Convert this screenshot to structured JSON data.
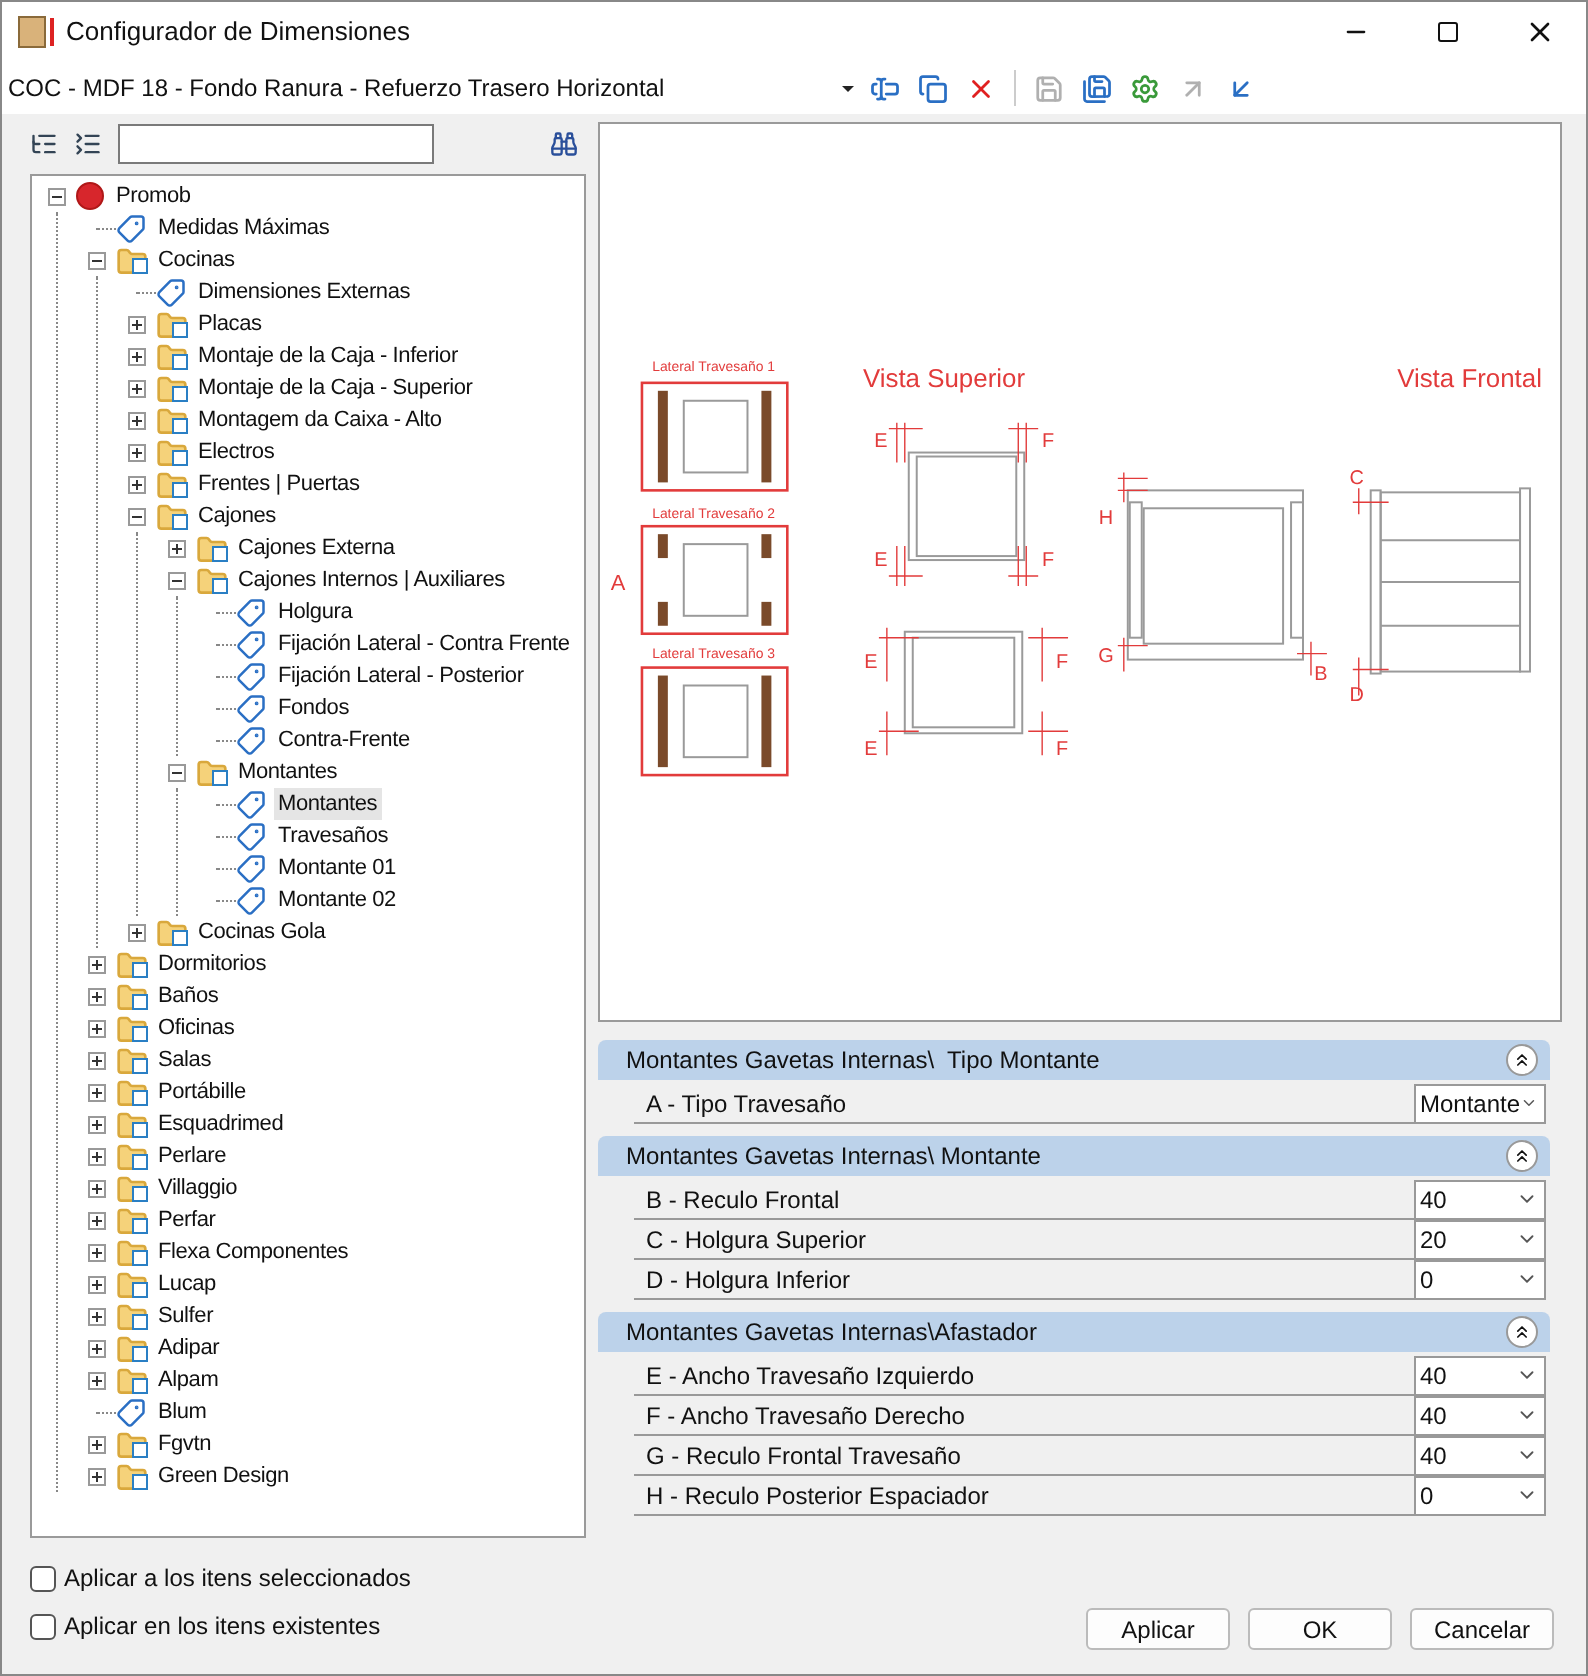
{
  "window": {
    "title": "Configurador de Dimensiones"
  },
  "toolbar": {
    "combo_value": "COC - MDF 18 - Fondo Ranura - Refuerzo Trasero Horizontal",
    "tools": [
      {
        "kind": "rename",
        "disabled": false
      },
      {
        "kind": "copy",
        "disabled": false
      },
      {
        "kind": "delete",
        "disabled": false
      },
      {
        "kind": "save",
        "disabled": true
      },
      {
        "kind": "saveas",
        "disabled": false
      },
      {
        "kind": "settings",
        "disabled": false
      },
      {
        "kind": "import",
        "disabled": true
      },
      {
        "kind": "export",
        "disabled": false
      }
    ]
  },
  "tree": {
    "items": [
      {
        "label": "Promob",
        "kind": "root",
        "expanded": true,
        "selected": false,
        "children": [
          {
            "label": "Medidas Máximas",
            "kind": "tag",
            "selected": false
          },
          {
            "label": "Cocinas",
            "kind": "folder",
            "expanded": true,
            "selected": false,
            "children": [
              {
                "label": "Dimensiones Externas",
                "kind": "tag",
                "selected": false
              },
              {
                "label": "Placas",
                "kind": "folder",
                "expanded": false,
                "selected": false
              },
              {
                "label": "Montaje de la Caja - Inferior",
                "kind": "folder",
                "expanded": false,
                "selected": false
              },
              {
                "label": "Montaje de la Caja - Superior",
                "kind": "folder",
                "expanded": false,
                "selected": false
              },
              {
                "label": "Montagem da Caixa - Alto",
                "kind": "folder",
                "expanded": false,
                "selected": false
              },
              {
                "label": "Electros",
                "kind": "folder",
                "expanded": false,
                "selected": false
              },
              {
                "label": "Frentes | Puertas",
                "kind": "folder",
                "expanded": false,
                "selected": false
              },
              {
                "label": "Cajones",
                "kind": "folder",
                "expanded": true,
                "selected": false,
                "children": [
                  {
                    "label": "Cajones Externa",
                    "kind": "folder",
                    "expanded": false,
                    "selected": false
                  },
                  {
                    "label": "Cajones Internos | Auxiliares",
                    "kind": "folder",
                    "expanded": true,
                    "selected": false,
                    "children": [
                      {
                        "label": "Holgura",
                        "kind": "tag",
                        "selected": false
                      },
                      {
                        "label": "Fijación Lateral - Contra Frente",
                        "kind": "tag",
                        "selected": false
                      },
                      {
                        "label": "Fijación Lateral - Posterior",
                        "kind": "tag",
                        "selected": false
                      },
                      {
                        "label": "Fondos",
                        "kind": "tag",
                        "selected": false
                      },
                      {
                        "label": "Contra-Frente",
                        "kind": "tag",
                        "selected": false
                      }
                    ]
                  },
                  {
                    "label": "Montantes",
                    "kind": "folder",
                    "expanded": true,
                    "selected": false,
                    "children": [
                      {
                        "label": "Montantes",
                        "kind": "tag",
                        "selected": true
                      },
                      {
                        "label": "Travesaños",
                        "kind": "tag",
                        "selected": false
                      },
                      {
                        "label": "Montante 01",
                        "kind": "tag",
                        "selected": false
                      },
                      {
                        "label": "Montante 02",
                        "kind": "tag",
                        "selected": false
                      }
                    ]
                  }
                ]
              },
              {
                "label": "Cocinas Gola",
                "kind": "folder",
                "expanded": false,
                "selected": false
              }
            ]
          },
          {
            "label": "Dormitorios",
            "kind": "folder",
            "expanded": false,
            "selected": false
          },
          {
            "label": "Baños",
            "kind": "folder",
            "expanded": false,
            "selected": false
          },
          {
            "label": "Oficinas",
            "kind": "folder",
            "expanded": false,
            "selected": false
          },
          {
            "label": "Salas",
            "kind": "folder",
            "expanded": false,
            "selected": false
          },
          {
            "label": "Portábille",
            "kind": "folder",
            "expanded": false,
            "selected": false
          },
          {
            "label": "Esquadrimed",
            "kind": "folder",
            "expanded": false,
            "selected": false
          },
          {
            "label": "Perlare",
            "kind": "folder",
            "expanded": false,
            "selected": false
          },
          {
            "label": "Villaggio",
            "kind": "folder",
            "expanded": false,
            "selected": false
          },
          {
            "label": "Perfar",
            "kind": "folder",
            "expanded": false,
            "selected": false
          },
          {
            "label": "Flexa Componentes",
            "kind": "folder",
            "expanded": false,
            "selected": false
          },
          {
            "label": "Lucap",
            "kind": "folder",
            "expanded": false,
            "selected": false
          },
          {
            "label": "Sulfer",
            "kind": "folder",
            "expanded": false,
            "selected": false
          },
          {
            "label": "Adipar",
            "kind": "folder",
            "expanded": false,
            "selected": false
          },
          {
            "label": "Alpam",
            "kind": "folder",
            "expanded": false,
            "selected": false
          },
          {
            "label": "Blum",
            "kind": "tag",
            "selected": false
          },
          {
            "label": "Fgvtn",
            "kind": "folder",
            "expanded": false,
            "selected": false
          },
          {
            "label": "Green Design",
            "kind": "folder",
            "expanded": false,
            "selected": false
          }
        ]
      }
    ]
  },
  "options": [
    {
      "label": "Aplicar a los itens seleccionados",
      "checked": false
    },
    {
      "label": "Aplicar en los itens existentes",
      "checked": false
    }
  ],
  "diagram": {
    "labels": [
      "Lateral Travesaño 1",
      "Lateral Travesaño 2",
      "Lateral Travesaño 3",
      "A",
      "Vista Superior",
      "Vista Frontal",
      "E",
      "F",
      "E",
      "F",
      "E",
      "F",
      "E",
      "F",
      "H",
      "G",
      "B",
      "C",
      "D"
    ]
  },
  "sections": [
    {
      "title": "Montantes Gavetas Internas\\  Tipo Montante",
      "expanded": true,
      "rows": [
        {
          "label": "A - Tipo Travesaño",
          "value": "Montante"
        }
      ]
    },
    {
      "title": "Montantes Gavetas Internas\\ Montante",
      "expanded": true,
      "rows": [
        {
          "label": "B - Reculo Frontal",
          "value": "40"
        },
        {
          "label": "C - Holgura Superior",
          "value": "20"
        },
        {
          "label": "D - Holgura Inferior",
          "value": "0"
        }
      ]
    },
    {
      "title": "Montantes Gavetas Internas\\Afastador",
      "expanded": true,
      "rows": [
        {
          "label": "E - Ancho Travesaño Izquierdo",
          "value": "40"
        },
        {
          "label": "F - Ancho Travesaño Derecho",
          "value": "40"
        },
        {
          "label": "G - Reculo Frontal Travesaño",
          "value": "40"
        },
        {
          "label": "H - Reculo Posterior Espaciador",
          "value": "0"
        }
      ]
    }
  ],
  "buttons": [
    "Aplicar",
    "OK",
    "Cancelar"
  ]
}
